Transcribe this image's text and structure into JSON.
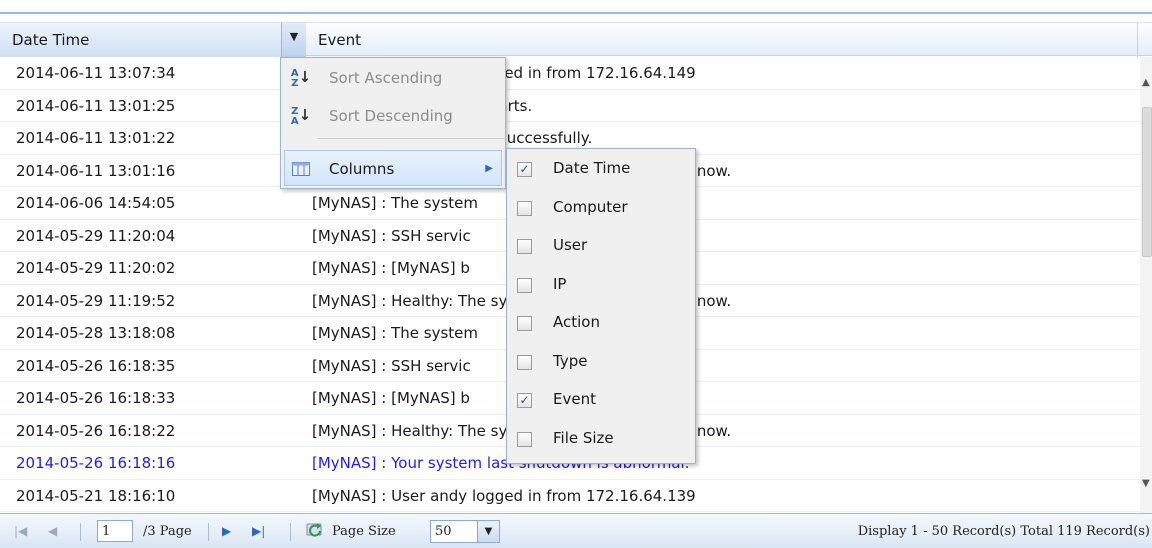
{
  "colors": {
    "accent": "#99bbe8",
    "alert_text": "#1f1fe0",
    "menu_bg": "#f0f0f0"
  },
  "grid": {
    "headers": {
      "date_time": "Date Time",
      "event": "Event"
    },
    "rows": [
      {
        "date": "2014-06-11 13:07:34",
        "event": "[MyNAS] : User andy logged in from 172.16.64.149",
        "alert": false
      },
      {
        "date": "2014-06-11 13:01:25",
        "event": "[MyNAS] : SSH service starts.",
        "alert": false
      },
      {
        "date": "2014-06-11 13:01:22",
        "event": "[MyNAS] : [MyNAS] boot successfully.",
        "alert": false
      },
      {
        "date": "2014-06-11 13:01:16",
        "event": "[MyNAS] : Healthy: The system [MyNAS] is healthy now.",
        "alert": false
      },
      {
        "date": "2014-06-06 14:54:05",
        "event": "[MyNAS] : The system",
        "alert": false
      },
      {
        "date": "2014-05-29 11:20:04",
        "event": "[MyNAS] : SSH servic",
        "alert": false
      },
      {
        "date": "2014-05-29 11:20:02",
        "event": "[MyNAS] : [MyNAS] b",
        "alert": false
      },
      {
        "date": "2014-05-29 11:19:52",
        "event": "[MyNAS] : Healthy: The system [MyNAS] is healthy now.",
        "alert": false
      },
      {
        "date": "2014-05-28 13:18:08",
        "event": "[MyNAS] : The system",
        "alert": false
      },
      {
        "date": "2014-05-26 16:18:35",
        "event": "[MyNAS] : SSH servic",
        "alert": false
      },
      {
        "date": "2014-05-26 16:18:33",
        "event": "[MyNAS] : [MyNAS] b",
        "alert": false
      },
      {
        "date": "2014-05-26 16:18:22",
        "event": "[MyNAS] : Healthy: The system [MyNAS] is healthy now.",
        "alert": false
      },
      {
        "date": "2014-05-26 16:18:16",
        "event": "[MyNAS] : Your system last shutdown is abnormal.",
        "alert": true
      },
      {
        "date": "2014-05-21 18:16:10",
        "event": "[MyNAS] : User andy logged in from 172.16.64.139",
        "alert": false
      }
    ]
  },
  "column_menu": {
    "sort_ascending": "Sort Ascending",
    "sort_descending": "Sort Descending",
    "columns": "Columns"
  },
  "columns_submenu": [
    {
      "label": "Date Time",
      "checked": true
    },
    {
      "label": "Computer",
      "checked": false
    },
    {
      "label": "User",
      "checked": false
    },
    {
      "label": "IP",
      "checked": false
    },
    {
      "label": "Action",
      "checked": false
    },
    {
      "label": "Type",
      "checked": false
    },
    {
      "label": "Event",
      "checked": true
    },
    {
      "label": "File Size",
      "checked": false
    }
  ],
  "pager": {
    "page_value": "1",
    "page_suffix": "/3 Page",
    "page_size_label": "Page Size",
    "page_size_value": "50",
    "display_text": "Display 1 - 50 Record(s) Total 119 Record(s)"
  }
}
